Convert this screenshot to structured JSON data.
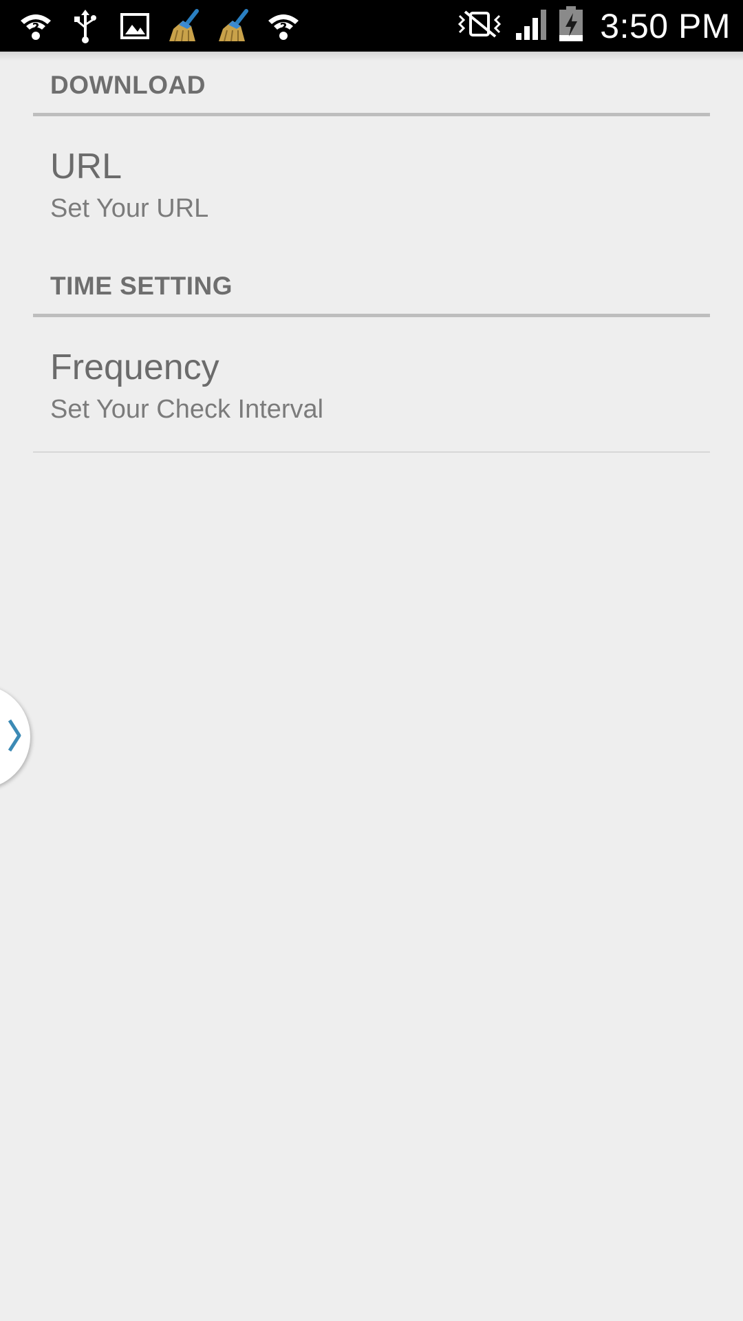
{
  "status_bar": {
    "left_icons": [
      "wifi-question-icon",
      "usb-icon",
      "image-icon",
      "broom-icon",
      "broom-icon",
      "wifi-question-icon"
    ],
    "right_icons": [
      "vibrate-mute-icon",
      "signal-icon",
      "battery-charging-icon"
    ],
    "time": "3:50 PM",
    "background": "#000000"
  },
  "preferences": {
    "categories": [
      {
        "title": "DOWNLOAD",
        "items": [
          {
            "title": "URL",
            "summary": "Set Your URL"
          }
        ]
      },
      {
        "title": "TIME SETTING",
        "items": [
          {
            "title": "Frequency",
            "summary": "Set Your Check Interval"
          }
        ]
      }
    ]
  },
  "side_handle": {
    "icon": "chevron-right-icon",
    "accent": "#3c8ab5"
  },
  "colors": {
    "background": "#eeeeee",
    "text_primary": "#6b6b6b",
    "text_secondary": "#7b7b7b",
    "category_line": "#bdbdbd"
  }
}
